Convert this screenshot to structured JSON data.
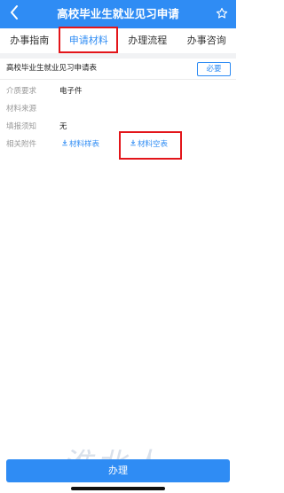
{
  "header": {
    "title": "高校毕业生就业见习申请",
    "back_icon": "chevron-left-icon",
    "favorite_icon": "star-outline-icon",
    "color": "#2f8cf4"
  },
  "tabs": [
    {
      "label": "办事指南",
      "active": false
    },
    {
      "label": "申请材料",
      "active": true
    },
    {
      "label": "办理流程",
      "active": false
    },
    {
      "label": "办事咨询",
      "active": false
    }
  ],
  "material": {
    "name": "高校毕业生就业见习申请表",
    "required_badge": "必要",
    "fields": [
      {
        "label": "介质要求",
        "value": "电子件"
      },
      {
        "label": "材料来源",
        "value": ""
      },
      {
        "label": "填报须知",
        "value": "无"
      }
    ],
    "attachments": {
      "label": "相关附件",
      "sample_link": "材料样表",
      "blank_link": "材料空表",
      "link_icon": "download-icon"
    }
  },
  "footer": {
    "handle_button": "办理"
  },
  "watermark": {
    "big": "淮北人",
    "small": "HUAIBEI.COM"
  },
  "colors": {
    "accent": "#2f8cf4",
    "highlight_box": "#e3151a"
  }
}
